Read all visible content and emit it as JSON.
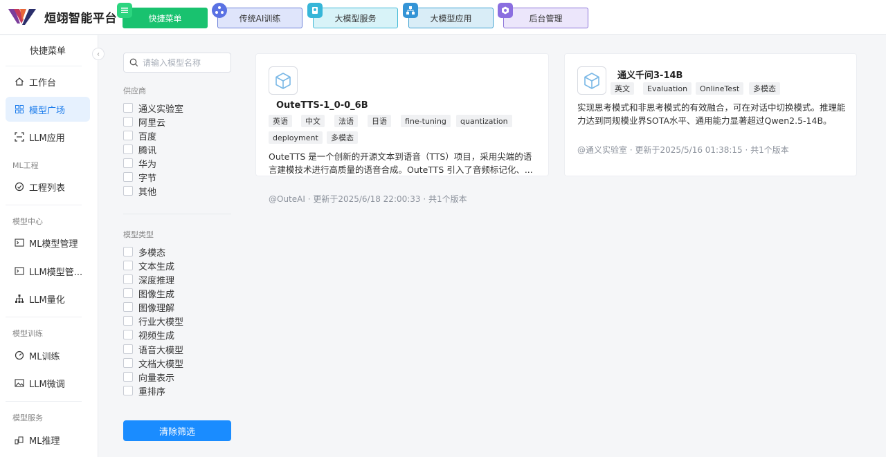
{
  "app": {
    "name": "烜翊智能平台"
  },
  "nav": [
    {
      "label": "快捷菜单",
      "icon": "menu-icon"
    },
    {
      "label": "传统AI训练",
      "icon": "recycle-icon"
    },
    {
      "label": "大模型服务",
      "icon": "ribbon-icon"
    },
    {
      "label": "大模型应用",
      "icon": "hierarchy-icon"
    },
    {
      "label": "后台管理",
      "icon": "settings-icon"
    }
  ],
  "sidebar": {
    "title": "快捷菜单",
    "items": [
      {
        "label": "工作台",
        "icon": "home-icon"
      },
      {
        "label": "模型广场",
        "icon": "grid-icon",
        "active": true
      },
      {
        "label": "LLM应用",
        "icon": "scan-icon"
      },
      {
        "label": "工程列表",
        "icon": "clock-icon"
      },
      {
        "label": "ML模型管理",
        "icon": "terminal-icon"
      },
      {
        "label": "LLM模型管...",
        "icon": "terminal-icon"
      },
      {
        "label": "LLM量化",
        "icon": "sitemap-icon"
      },
      {
        "label": "ML训练",
        "icon": "gauge-icon"
      },
      {
        "label": "LLM微调",
        "icon": "image-icon"
      },
      {
        "label": "ML推理",
        "icon": "rocket-icon"
      }
    ],
    "groups": [
      "ML工程",
      "模型中心",
      "模型训练",
      "模型服务"
    ]
  },
  "filters": {
    "search_placeholder": "请输入模型名称",
    "provider_title": "供应商",
    "providers": [
      "通义实验室",
      "阿里云",
      "百度",
      "腾讯",
      "华为",
      "字节",
      "其他"
    ],
    "type_title": "模型类型",
    "types": [
      "多模态",
      "文本生成",
      "深度推理",
      "图像生成",
      "图像理解",
      "行业大模型",
      "视频生成",
      "语音大模型",
      "文档大模型",
      "向量表示",
      "重排序"
    ],
    "clear_label": "清除筛选"
  },
  "cards": [
    {
      "title": "OuteTTS-1_0-0_6B",
      "tags": [
        "英语",
        "中文",
        "法语",
        "日语",
        "fine-tuning",
        "quantization",
        "deployment",
        "多模态"
      ],
      "description": "OuteTTS 是一个创新的开源文本到语音（TTS）项目，采用尖端的语言建模技术进行高质量的语音合成。OuteTTS 引入了音频标记化、...",
      "meta": "@OuteAI · 更新于2025/6/18 22:00:33 · 共1个版本"
    },
    {
      "title": "通义千问3-14B",
      "tags": [
        "英文",
        "Evaluation",
        "OnlineTest",
        "多模态"
      ],
      "description": "实现思考模式和非思考模式的有效融合，可在对话中切换模式。推理能力达到同规模业界SOTA水平、通用能力显著超过Qwen2.5-14B。",
      "meta": "@通义实验室 · 更新于2025/5/16 01:38:15 · 共1个版本"
    }
  ],
  "colors": {
    "accent": "#1a8cff",
    "active_bg": "#e6f1fe",
    "nav_green": "#19c26f"
  }
}
